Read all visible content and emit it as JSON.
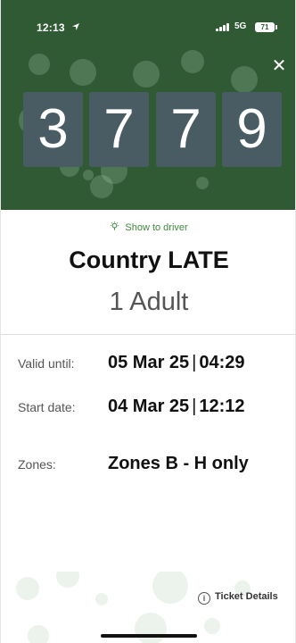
{
  "status_bar": {
    "time": "12:13",
    "network": "5G",
    "battery": "71"
  },
  "header": {
    "close_icon": "close-icon",
    "code_digits": [
      "3",
      "7",
      "7",
      "9"
    ]
  },
  "ticket": {
    "show_to_driver": "Show to driver",
    "type": "Country LATE",
    "passengers": "1 Adult",
    "valid_until": {
      "label": "Valid until:",
      "date": "05 Mar 25",
      "separator": "|",
      "time": "04:29"
    },
    "start_date": {
      "label": "Start date:",
      "date": "04 Mar 25",
      "separator": "|",
      "time": "12:12"
    },
    "zones": {
      "label": "Zones:",
      "value": "Zones B - H only"
    }
  },
  "footer": {
    "ticket_details": "Ticket Details",
    "info_icon": "info-icon"
  },
  "colors": {
    "header_green": "#2f5a33",
    "digit_tile": "#4a5c63",
    "accent_green": "#3d8a3d"
  }
}
